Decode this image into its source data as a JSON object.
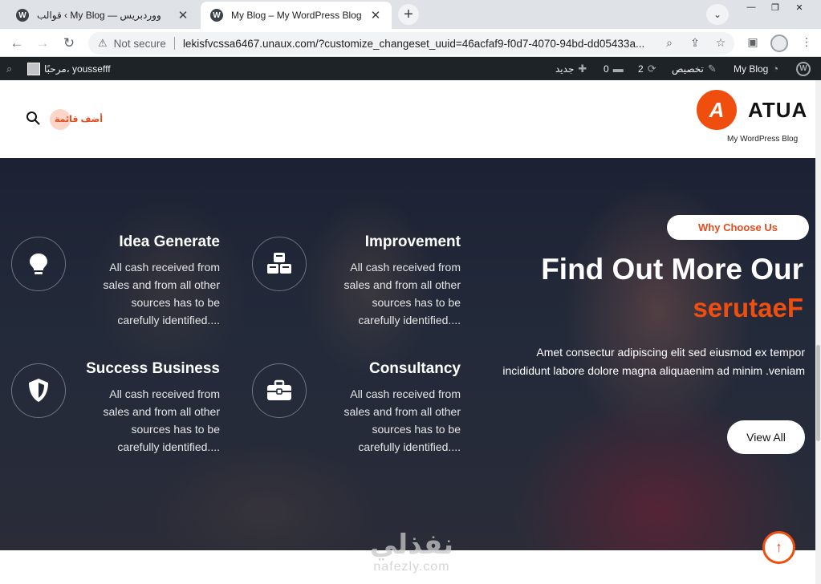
{
  "browser": {
    "tabs": [
      {
        "title": "قوالب ‹ My Blog — ووردبريس",
        "icon": "wordpress-icon",
        "active": false
      },
      {
        "title": "My Blog – My WordPress Blog",
        "icon": "wordpress-icon",
        "active": true
      }
    ],
    "new_tab_icon": "plus-icon",
    "address": {
      "security_label": "Not secure",
      "url": "lekisfvcssa6467.unaux.com/?customize_changeset_uuid=46acfaf9-f0d7-4070-94bd-dd05433a..."
    }
  },
  "adminbar": {
    "site_name": "My Blog",
    "customize_label": "تخصيص",
    "updates_count": "2",
    "comments_count": "0",
    "new_label": "جديد",
    "greeting": "مرحبًا، youssefff"
  },
  "header": {
    "logo_letter": "A",
    "logo_text": "ATUA",
    "tagline": "My WordPress Blog",
    "add_menu_label": "أضف قائمة"
  },
  "hero": {
    "badge": "Why Choose Us",
    "title": "Find Out More Our",
    "accent": "serutaeF",
    "description": "Amet consectur adipiscing elit sed eiusmod ex tempor incididunt labore dolore magna aliquaenim ad minim .veniam",
    "cta_label": "View All",
    "features": [
      {
        "title": "Idea Generate",
        "icon": "lightbulb-icon",
        "desc": "All cash received from sales and from all other sources has to be carefully identified...."
      },
      {
        "title": "Improvement",
        "icon": "cubes-icon",
        "desc": "All cash received from sales and from all other sources has to be carefully identified...."
      },
      {
        "title": "Success Business",
        "icon": "shield-icon",
        "desc": "All cash received from sales and from all other sources has to be carefully identified...."
      },
      {
        "title": "Consultancy",
        "icon": "briefcase-icon",
        "desc": "All cash received from sales and from all other sources has to be carefully identified...."
      }
    ]
  },
  "watermark": {
    "arabic": "نفذلي",
    "latin": "nafezly.com"
  },
  "colors": {
    "accent": "#f04e0f",
    "adminbar": "#1d2327",
    "hero_dark": "#1c2233"
  }
}
